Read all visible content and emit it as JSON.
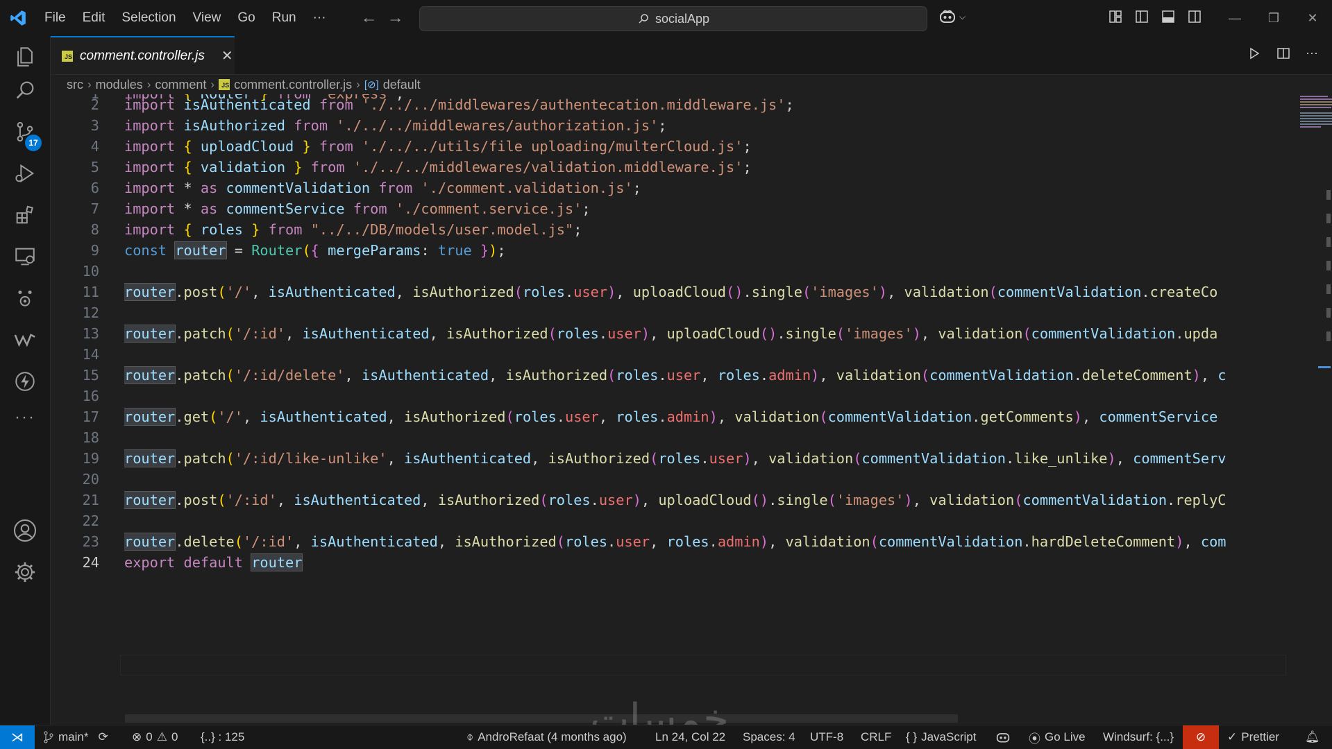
{
  "menu": {
    "items": [
      "File",
      "Edit",
      "Selection",
      "View",
      "Go",
      "Run",
      "···"
    ]
  },
  "search": {
    "text": "socialApp"
  },
  "tab": {
    "name": "comment.controller.js",
    "close": "✕",
    "icon": "JS"
  },
  "breadcrumb": {
    "items": [
      "src",
      "modules",
      "comment",
      "comment.controller.js",
      "default"
    ]
  },
  "activity": {
    "badge": "17"
  },
  "editor": {
    "line_numbers": [
      "2",
      "3",
      "4",
      "5",
      "6",
      "7",
      "8",
      "9",
      "10",
      "11",
      "12",
      "13",
      "14",
      "15",
      "16",
      "17",
      "18",
      "19",
      "20",
      "21",
      "22",
      "23",
      "24"
    ],
    "line1_partial": "import { Router } from 'express';",
    "lines": [
      "import isAuthenticated from './../../middlewares/authentecation.middleware.js';",
      "import isAuthorized from './../../middlewares/authorization.js';",
      "import { uploadCloud } from './../../utils/file uploading/multerCloud.js';",
      "import { validation } from './../../middlewares/validation.middleware.js';",
      "import * as commentValidation from './comment.validation.js';",
      "import * as commentService from './comment.service.js';",
      "import { roles } from \"../../DB/models/user.model.js\";",
      "const router = Router({ mergeParams: true });",
      "",
      "router.post('/', isAuthenticated, isAuthorized(roles.user), uploadCloud().single('images'), validation(commentValidation.createCo",
      "",
      "router.patch('/:id', isAuthenticated, isAuthorized(roles.user), uploadCloud().single('images'), validation(commentValidation.upda",
      "",
      "router.patch('/:id/delete', isAuthenticated, isAuthorized(roles.user, roles.admin), validation(commentValidation.deleteComment), c",
      "",
      "router.get('/', isAuthenticated, isAuthorized(roles.user, roles.admin), validation(commentValidation.getComments), commentService",
      "",
      "router.patch('/:id/like-unlike', isAuthenticated, isAuthorized(roles.user), validation(commentValidation.like_unlike), commentServ",
      "",
      "router.post('/:id', isAuthenticated, isAuthorized(roles.user), uploadCloud().single('images'), validation(commentValidation.replyC",
      "",
      "router.delete('/:id', isAuthenticated, isAuthorized(roles.user, roles.admin), validation(commentValidation.hardDeleteComment), com",
      "export default router"
    ]
  },
  "status": {
    "branch": "main*",
    "errors": "0",
    "warnings": "0",
    "selection": "{..} : 125",
    "blame": "AndroRefaat (4 months ago)",
    "position": "Ln 24, Col 22",
    "spaces": "Spaces: 4",
    "encoding": "UTF-8",
    "eol": "CRLF",
    "language": "JavaScript",
    "golive": "Go Live",
    "windsurf": "Windsurf: {...}",
    "prettier": "Prettier"
  },
  "watermark": "خمسات",
  "colors": {
    "accent": "#0078d4",
    "background": "#1f1f1f",
    "statusbar_alert": "#c72e0f"
  }
}
